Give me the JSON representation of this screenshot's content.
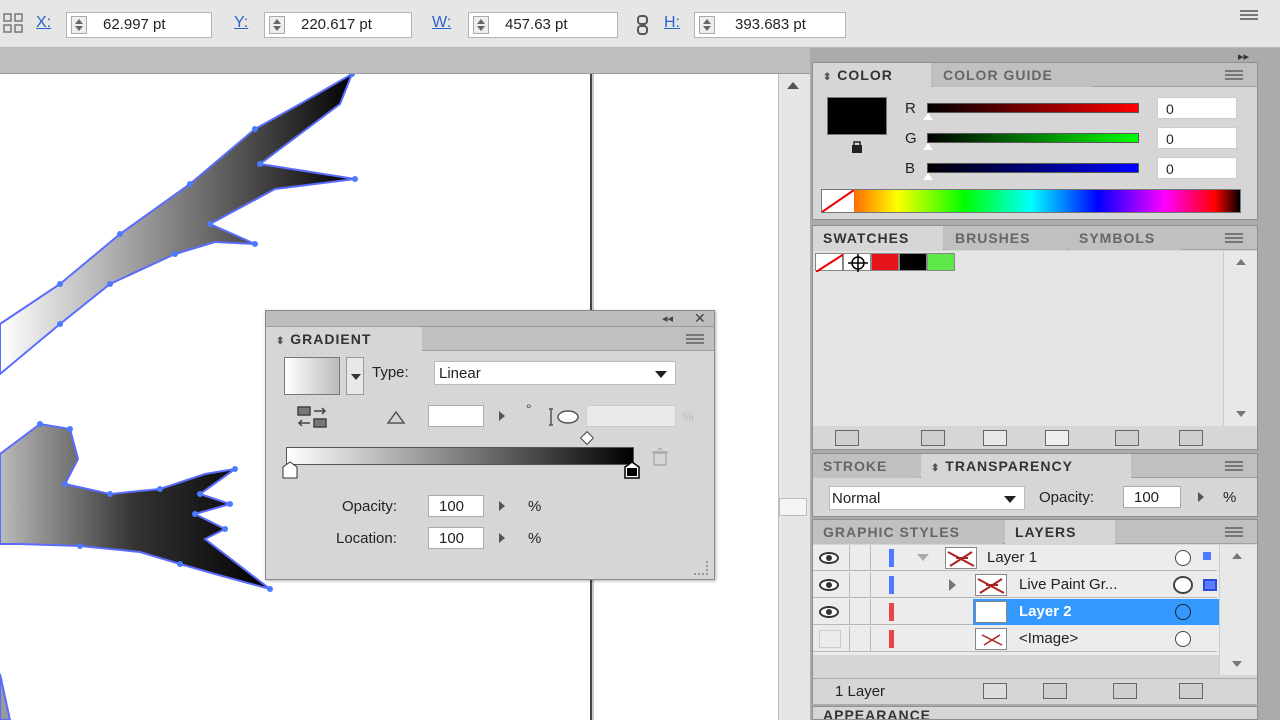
{
  "control_bar": {
    "x_label": "X:",
    "x_value": "62.997 pt",
    "y_label": "Y:",
    "y_value": "220.617 pt",
    "w_label": "W:",
    "w_value": "457.63 pt",
    "h_label": "H:",
    "h_value": "393.683 pt"
  },
  "gradient_panel": {
    "title": "GRADIENT",
    "type_label": "Type:",
    "type_value": "Linear",
    "angle_value": "",
    "aspect_value": "",
    "aspect_unit": "%",
    "degree_symbol": "°",
    "opacity_label": "Opacity:",
    "opacity_value": "100",
    "location_label": "Location:",
    "location_value": "100",
    "percent": "%"
  },
  "color_panel": {
    "tabs": [
      "COLOR",
      "COLOR GUIDE"
    ],
    "r_label": "R",
    "r_value": "0",
    "g_label": "G",
    "g_value": "0",
    "b_label": "B",
    "b_value": "0",
    "fill_color": "#000000"
  },
  "swatches_panel": {
    "tabs": [
      "SWATCHES",
      "BRUSHES",
      "SYMBOLS"
    ],
    "swatch_colors": [
      "none",
      "registration",
      "#e8141c",
      "#000000",
      "#5ee84a"
    ]
  },
  "transparency_panel": {
    "tabs": [
      "STROKE",
      "TRANSPARENCY"
    ],
    "blend_mode": "Normal",
    "opacity_label": "Opacity:",
    "opacity_value": "100",
    "percent": "%"
  },
  "layers_panel": {
    "tabs": [
      "GRAPHIC STYLES",
      "LAYERS"
    ],
    "rows": [
      {
        "name": "Layer 1",
        "color": "#4c7bff"
      },
      {
        "name": "Live Paint Gr...",
        "color": "#4c7bff"
      },
      {
        "name": "Layer 2",
        "color": "#e8454a"
      },
      {
        "name": "<Image>",
        "color": "#e8454a"
      }
    ],
    "status": "1 Layer"
  },
  "appearance_panel": {
    "title": "APPEARANCE"
  },
  "colors": {
    "accent": "#3399ff",
    "selection_outline": "#5a6cff"
  }
}
